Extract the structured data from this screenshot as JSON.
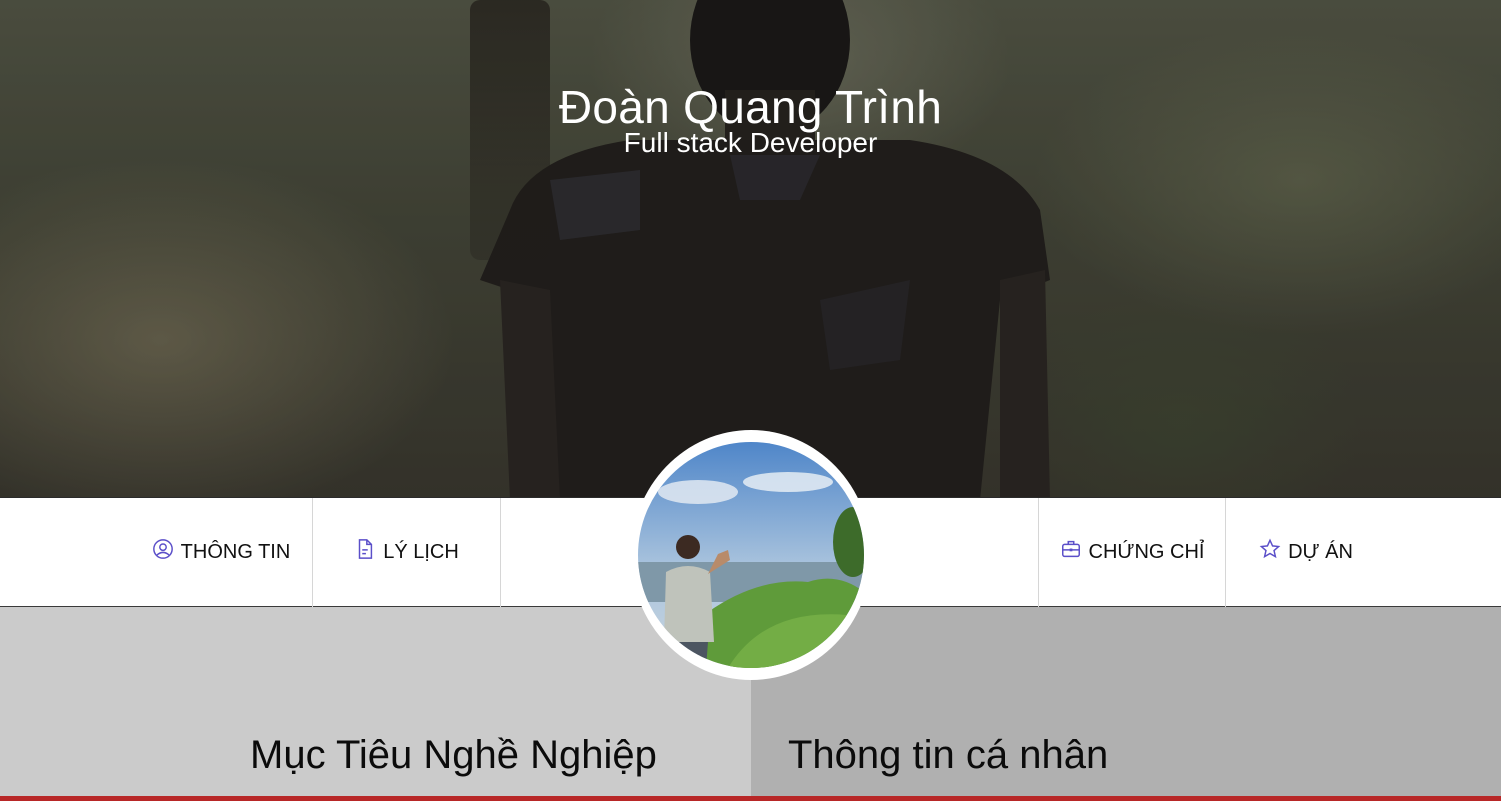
{
  "profile": {
    "name": "Đoàn Quang Trình",
    "role": "Full stack Developer"
  },
  "nav": {
    "items": [
      {
        "label": "THÔNG TIN",
        "icon": "user-circle-icon"
      },
      {
        "label": "LÝ LỊCH",
        "icon": "document-icon"
      },
      {
        "label": "CHỨNG CHỈ",
        "icon": "briefcase-icon"
      },
      {
        "label": "DỰ ÁN",
        "icon": "star-icon"
      }
    ],
    "icon_color": "#5b4fc9"
  },
  "sections": {
    "left_title": "Mục Tiêu Nghề Nghiệp",
    "right_title": "Thông tin cá nhân"
  },
  "colors": {
    "accent_line": "#b82727",
    "section_left_bg": "#cbcbcb",
    "section_right_bg": "#b0b0b0"
  }
}
